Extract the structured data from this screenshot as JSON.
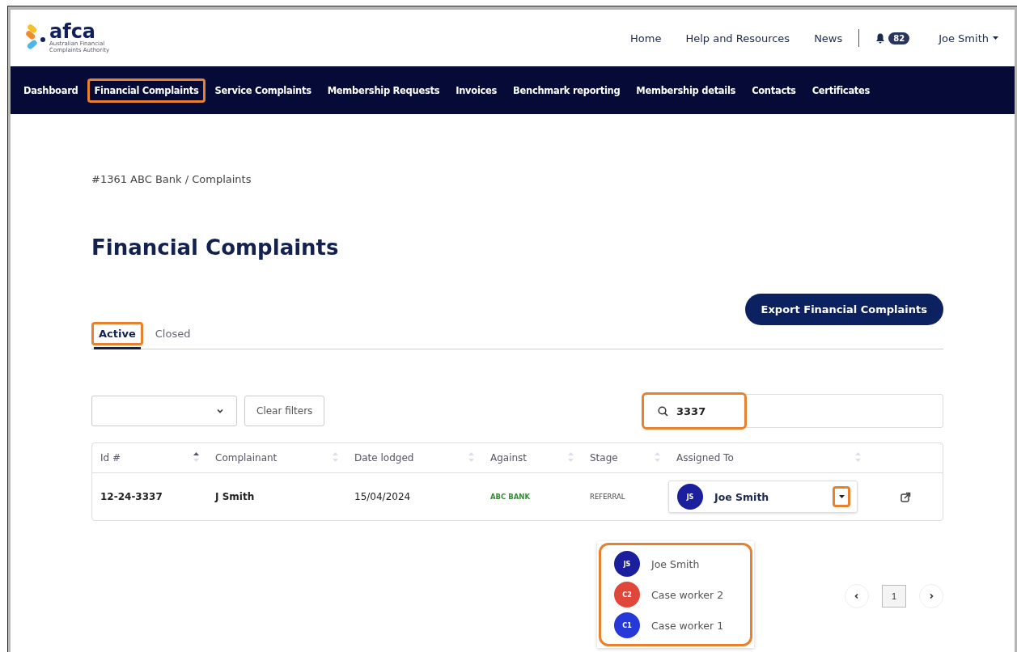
{
  "logo": {
    "wordmark": "afca",
    "tagline": "Australian Financial Complaints Authority"
  },
  "top_links": [
    {
      "label": "Home"
    },
    {
      "label": "Help and Resources"
    },
    {
      "label": "News"
    }
  ],
  "notifications": {
    "count": "82"
  },
  "user_menu": {
    "label": "Joe Smith"
  },
  "nav": [
    {
      "label": "Dashboard",
      "highlighted": false
    },
    {
      "label": "Financial Complaints",
      "highlighted": true
    },
    {
      "label": "Service Complaints",
      "highlighted": false
    },
    {
      "label": "Membership Requests",
      "highlighted": false
    },
    {
      "label": "Invoices",
      "highlighted": false
    },
    {
      "label": "Benchmark reporting",
      "highlighted": false
    },
    {
      "label": "Membership details",
      "highlighted": false
    },
    {
      "label": "Contacts",
      "highlighted": false
    },
    {
      "label": "Certificates",
      "highlighted": false
    }
  ],
  "breadcrumb": "#1361 ABC Bank / Complaints",
  "page_title": "Financial Complaints",
  "export_button": "Export Financial Complaints",
  "tabs": [
    {
      "label": "Active",
      "selected": true,
      "highlighted": true
    },
    {
      "label": "Closed",
      "selected": false,
      "highlighted": false
    }
  ],
  "filters": {
    "clear_button": "Clear filters"
  },
  "search": {
    "value": "3337",
    "highlighted": true
  },
  "table": {
    "columns": [
      {
        "label": "Id #",
        "sorted": true
      },
      {
        "label": "Complainant",
        "sorted": false
      },
      {
        "label": "Date lodged",
        "sorted": false
      },
      {
        "label": "Against",
        "sorted": false
      },
      {
        "label": "Stage",
        "sorted": false
      },
      {
        "label": "Assigned To",
        "sorted": false
      }
    ],
    "rows": [
      {
        "id": "12-24-3337",
        "complainant": "J Smith",
        "date_lodged": "15/04/2024",
        "against": "ABC BANK",
        "stage": "REFERRAL",
        "assigned": {
          "initials": "JS",
          "name": "Joe Smith",
          "color": "#1b1f9e"
        },
        "caret_highlighted": true
      }
    ]
  },
  "assign_menu": {
    "highlighted": true,
    "options": [
      {
        "initials": "JS",
        "name": "Joe Smith",
        "color": "#1b1f9e"
      },
      {
        "initials": "C2",
        "name": "Case worker 2",
        "color": "#e0463a"
      },
      {
        "initials": "C1",
        "name": "Case worker 1",
        "color": "#2638d8"
      }
    ]
  },
  "pagination": {
    "current": "1"
  }
}
